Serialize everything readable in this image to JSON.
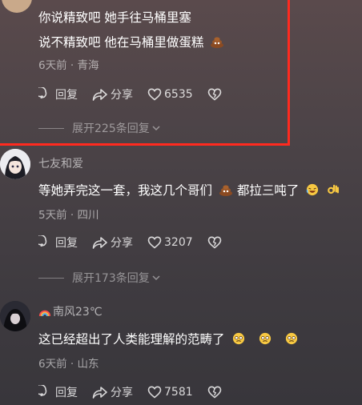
{
  "comments": [
    {
      "lines": [
        "你说精致吧 她手往马桶里塞",
        "说不精致吧 他在马桶里做蛋糕"
      ],
      "time": "6天前",
      "location": "青海",
      "reply_label": "回复",
      "share_label": "分享",
      "likes": "6535",
      "replies": "展开225条回复"
    },
    {
      "username": "七友和爱",
      "text_a": "等她弄完这一套，我这几个哥们",
      "text_b": "都拉三吨了",
      "time": "5天前",
      "location": "四川",
      "reply_label": "回复",
      "share_label": "分享",
      "likes": "3207",
      "replies": "展开173条回复"
    },
    {
      "username": "南风23℃",
      "text": "这已经超出了人类能理解的范畴了",
      "time": "6天前",
      "location": "山东",
      "reply_label": "回复",
      "share_label": "分享",
      "likes": "7581"
    }
  ],
  "colors": {
    "highlight_border": "#ff2a1f",
    "poop": "#8a4a22"
  }
}
